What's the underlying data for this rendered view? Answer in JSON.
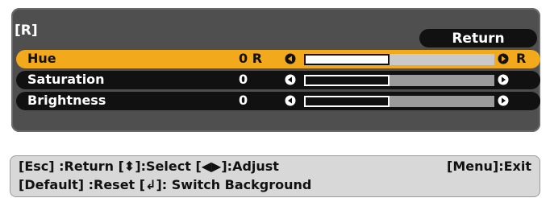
{
  "panel": {
    "title": "[R]",
    "return_label": "Return",
    "rows": [
      {
        "label": "Hue",
        "value": "0 R",
        "right_tag": "R",
        "level": 0.45,
        "active": true
      },
      {
        "label": "Saturation",
        "value": "0",
        "right_tag": "",
        "level": 0.45,
        "active": false
      },
      {
        "label": "Brightness",
        "value": "0",
        "right_tag": "",
        "level": 0.45,
        "active": false
      }
    ],
    "icons": {
      "left": "left-arrow-icon",
      "right": "right-arrow-icon"
    },
    "colors": {
      "panel": "#4f4f4f",
      "active_row": "#f2a91b",
      "row": "#111111",
      "text": "#ffffff"
    }
  },
  "status": {
    "line1": "[Esc] :Return  [⬍]:Select  [◀▶]:Adjust",
    "menu_exit": "[Menu]:Exit",
    "line2": "[Default] :Reset  [↲]: Switch Background"
  }
}
